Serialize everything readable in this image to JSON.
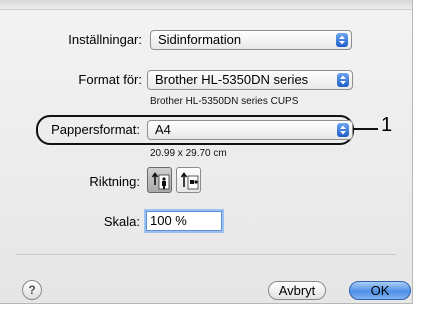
{
  "settings": {
    "label": "Inställningar:",
    "value": "Sidinformation"
  },
  "format_for": {
    "label": "Format för:",
    "value": "Brother HL-5350DN series",
    "subtext": "Brother HL-5350DN series CUPS"
  },
  "paper_size": {
    "label": "Pappersformat:",
    "value": "A4",
    "dimensions": "20.99 x 29.70 cm"
  },
  "callout": {
    "number": "1"
  },
  "orientation": {
    "label": "Riktning:",
    "selected": "portrait"
  },
  "scale": {
    "label": "Skala:",
    "value": "100 %"
  },
  "footer": {
    "help": "?",
    "cancel": "Avbryt",
    "ok": "OK"
  },
  "colors": {
    "accent": "#3d7fe0",
    "popup_arrows": "#1d5ec8"
  }
}
